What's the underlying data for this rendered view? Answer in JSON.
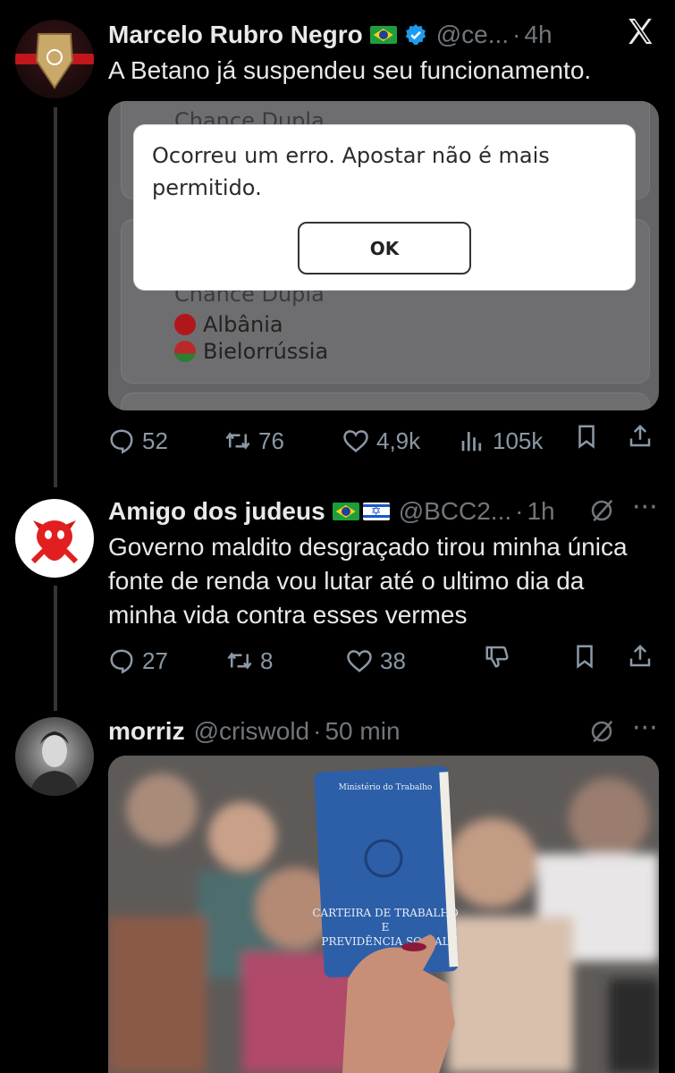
{
  "app": {
    "close_icon": "x-logo-icon"
  },
  "tweets": [
    {
      "author": "Marcelo Rubro Negro",
      "handle": "@ce...",
      "time": "4h",
      "text": "A Betano já suspendeu seu funcionamento.",
      "embed": {
        "card_label_top": "Chance Dupla",
        "card_label_mid": "Chance Dupla",
        "team1": "Albânia",
        "team2": "Bielorrússia",
        "dialog_message": "Ocorreu um erro. Apostar não é mais permitido.",
        "dialog_button": "OK"
      },
      "stats": {
        "replies": "52",
        "retweets": "76",
        "likes": "4,9k",
        "views": "105k"
      }
    },
    {
      "author": "Amigo dos judeus",
      "handle": "@BCC2...",
      "time": "1h",
      "text": "Governo maldito desgraçado tirou minha única fonte de renda vou lutar até o ultimo dia da minha vida contra esses vermes",
      "stats": {
        "replies": "27",
        "retweets": "8",
        "likes": "38"
      }
    },
    {
      "author": "morriz",
      "handle": "@criswold",
      "time": "50 min",
      "photo": {
        "booklet_line1": "Ministério do Trabalho",
        "booklet_line2": "CARTEIRA DE TRABALHO",
        "booklet_line3": "E",
        "booklet_line4": "PREVIDÊNCIA SOCIAL"
      }
    }
  ],
  "separator": "·",
  "colors": {
    "background": "#000000",
    "text": "#e7e9ea",
    "muted": "#71767b",
    "verified": "#1d9bf0"
  }
}
